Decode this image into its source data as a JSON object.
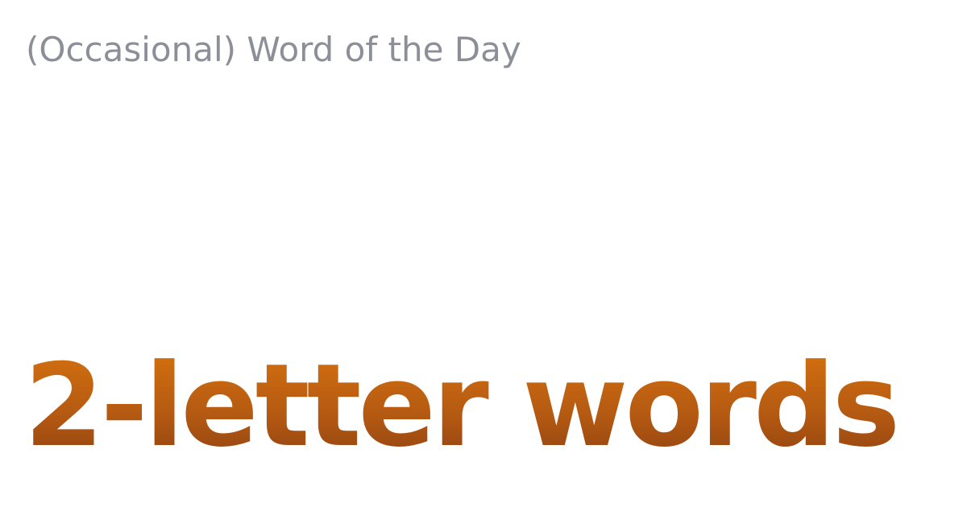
{
  "card": {
    "kicker": "(Occasional) Word of the Day",
    "headline": "2-letter words"
  },
  "colors": {
    "background": "#ffffff",
    "kicker_text": "#8c8f98",
    "headline_gradient_top": "#d8740e",
    "headline_gradient_bottom": "#8a3e12"
  }
}
